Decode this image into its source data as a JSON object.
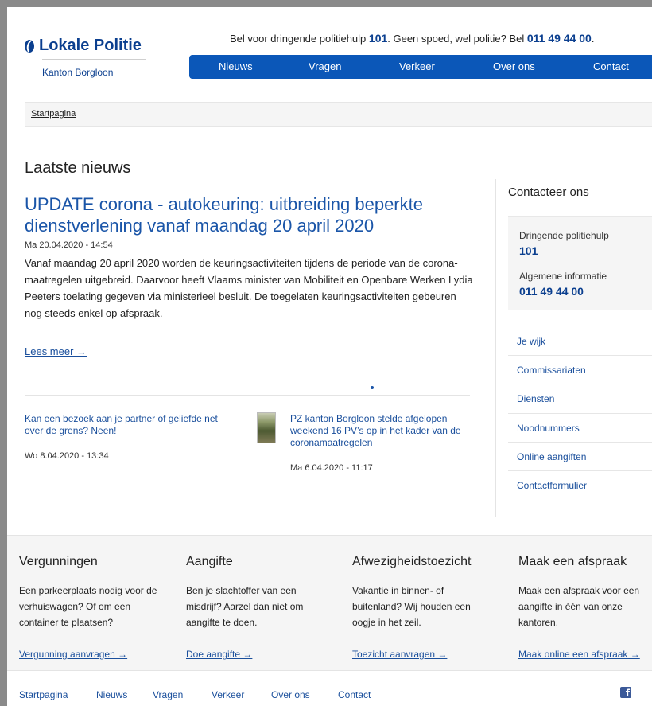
{
  "header": {
    "logo_title": "Lokale Politie",
    "logo_subtitle": "Kanton Borgloon",
    "topline_prefix": "Bel voor dringende politiehulp ",
    "topline_num1": "101",
    "topline_middle": ". Geen spoed, wel politie? Bel ",
    "topline_num2": "011 49 44 00",
    "topline_suffix": ".",
    "nav": [
      "Nieuws",
      "Vragen",
      "Verkeer",
      "Over ons",
      "Contact"
    ]
  },
  "breadcrumb": {
    "home": "Startpagina"
  },
  "main": {
    "section_title": "Laatste nieuws",
    "featured": {
      "title": "UPDATE corona - autokeuring: uitbreiding beperkte dienstverlening vanaf maandag 20 april 2020",
      "date": "Ma 20.04.2020 - 14:54",
      "intro": "Vanaf maandag 20 april 2020 worden de keuringsactiviteiten tijdens de periode van de corona-maatregelen uitgebreid. Daarvoor heeft Vlaams minister van Mobiliteit en Openbare Werken Lydia Peeters toelating gegeven via ministerieel besluit. De toegelaten keuringsactiviteiten gebeuren nog steeds enkel op afspraak.",
      "read_more": "Lees meer →"
    },
    "articles": [
      {
        "title": "Kan een bezoek aan je partner of geliefde net over de grens? Neen!",
        "date": "Wo 8.04.2020 - 13:34"
      },
      {
        "title": "PZ kanton Borgloon stelde afgelopen weekend 16 PV’s op in het kader van de coronamaatregelen",
        "date": "Ma 6.04.2020 - 11:17"
      }
    ]
  },
  "sidebar": {
    "title": "Contacteer ons",
    "urgent_label": "Dringende politiehulp",
    "urgent_number": "101",
    "info_label": "Algemene informatie",
    "info_number": "011 49 44 00",
    "links": [
      "Je wijk",
      "Commissariaten",
      "Diensten",
      "Noodnummers",
      "Online aangiften",
      "Contactformulier"
    ]
  },
  "cards": [
    {
      "title": "Vergunningen",
      "text": "Een parkeerplaats nodig voor de verhuiswagen? Of om een container te plaatsen?",
      "link": "Vergunning aanvragen →"
    },
    {
      "title": "Aangifte",
      "text": "Ben je slachtoffer van een misdrijf? Aarzel dan niet om aangifte te doen.",
      "link": "Doe aangifte →"
    },
    {
      "title": "Afwezigheidstoezicht",
      "text": "Vakantie in binnen- of buitenland? Wij houden een oogje in het zeil.",
      "link": "Toezicht aanvragen →"
    },
    {
      "title": "Maak een afspraak",
      "text": "Maak een afspraak voor een aangifte in één van onze kantoren.",
      "link": "Maak online een afspraak →"
    }
  ],
  "footer_nav": [
    "Startpagina",
    "Nieuws",
    "Vragen",
    "Verkeer",
    "Over ons",
    "Contact"
  ],
  "colors": {
    "brand_blue": "#0b57b8",
    "link_blue": "#1a4f9c",
    "headline_blue": "#1a55a8",
    "panel_grey": "#f5f5f5"
  },
  "icons": {
    "logo": "police-shield-icon",
    "social": "facebook-icon"
  }
}
